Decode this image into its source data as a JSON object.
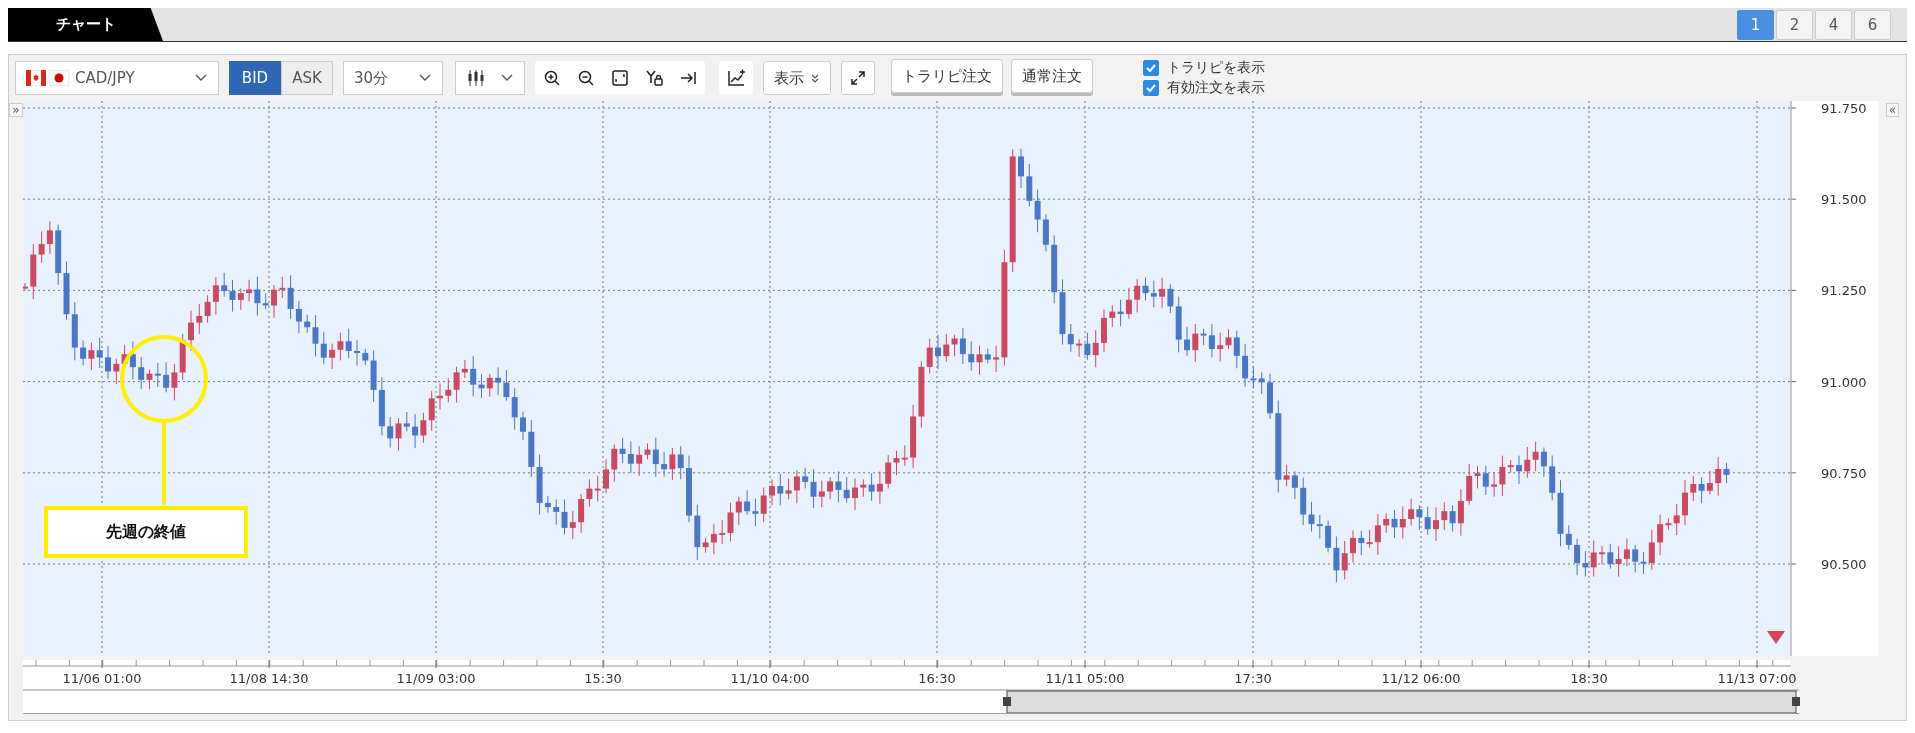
{
  "tabs": [
    {
      "label": "チャート",
      "selected": true
    }
  ],
  "layout_buttons": [
    {
      "label": "1",
      "selected": true
    },
    {
      "label": "2",
      "selected": false
    },
    {
      "label": "4",
      "selected": false
    },
    {
      "label": "6",
      "selected": false
    }
  ],
  "toolbar": {
    "pair": "CAD/JPY",
    "price_sides": [
      {
        "label": "BID",
        "selected": true
      },
      {
        "label": "ASK",
        "selected": false
      }
    ],
    "interval": "30分",
    "display_menu": "表示",
    "order_buttons": [
      "トラリピ注文",
      "通常注文"
    ],
    "toggles": [
      {
        "label": "トラリピを表示",
        "checked": true
      },
      {
        "label": "有効注文を表示",
        "checked": true
      }
    ]
  },
  "chart": {
    "left_toggle": "»",
    "right_toggle": "«",
    "price_labels": [
      "91.750",
      "91.500",
      "91.250",
      "91.000",
      "90.750",
      "90.500"
    ],
    "time_labels": [
      "11/06 01:00",
      "11/08 14:30",
      "11/09 03:00",
      "15:30",
      "11/10 04:00",
      "16:30",
      "11/11 05:00",
      "17:30",
      "11/12 06:00",
      "18:30",
      "11/13 07:00"
    ],
    "annotation": "先週の終値"
  }
}
